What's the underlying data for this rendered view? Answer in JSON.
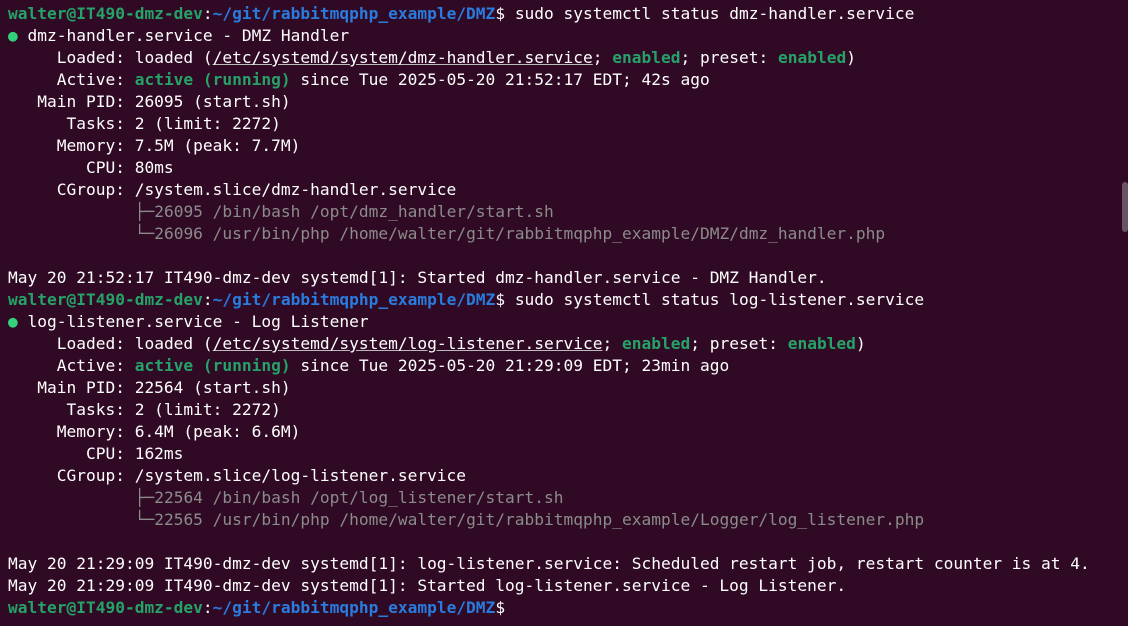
{
  "prompt": {
    "user_host": "walter@IT490-dmz-dev",
    "sep": ":",
    "path": "~/git/rabbitmqphp_example/DMZ",
    "dollar": "$ "
  },
  "commands": {
    "first": "sudo systemctl status dmz-handler.service",
    "second": "sudo systemctl status log-listener.service"
  },
  "service1": {
    "bullet": "●",
    "header": " dmz-handler.service - DMZ Handler",
    "loaded_label": "     Loaded: ",
    "loaded_pre": "loaded (",
    "loaded_path": "/etc/systemd/system/dmz-handler.service",
    "loaded_sep": "; ",
    "enabled1": "enabled",
    "loaded_mid": "; preset: ",
    "enabled2": "enabled",
    "loaded_end": ")",
    "active_label": "     Active: ",
    "active_state": "active (running)",
    "active_since": " since Tue 2025-05-20 21:52:17 EDT; 42s ago",
    "main_pid": "   Main PID: 26095 (start.sh)",
    "tasks": "      Tasks: 2 (limit: 2272)",
    "memory": "     Memory: 7.5M (peak: 7.7M)",
    "cpu": "        CPU: 80ms",
    "cgroup": "     CGroup: /system.slice/dmz-handler.service",
    "tree_indent": "             ",
    "proc1_branch": "├─",
    "proc1": "26095 /bin/bash /opt/dmz_handler/start.sh",
    "proc2_branch": "└─",
    "proc2": "26096 /usr/bin/php /home/walter/git/rabbitmqphp_example/DMZ/dmz_handler.php",
    "log1": "May 20 21:52:17 IT490-dmz-dev systemd[1]: Started dmz-handler.service - DMZ Handler."
  },
  "service2": {
    "bullet": "●",
    "header": " log-listener.service - Log Listener",
    "loaded_label": "     Loaded: ",
    "loaded_pre": "loaded (",
    "loaded_path": "/etc/systemd/system/log-listener.service",
    "loaded_sep": "; ",
    "enabled1": "enabled",
    "loaded_mid": "; preset: ",
    "enabled2": "enabled",
    "loaded_end": ")",
    "active_label": "     Active: ",
    "active_state": "active (running)",
    "active_since": " since Tue 2025-05-20 21:29:09 EDT; 23min ago",
    "main_pid": "   Main PID: 22564 (start.sh)",
    "tasks": "      Tasks: 2 (limit: 2272)",
    "memory": "     Memory: 6.4M (peak: 6.6M)",
    "cpu": "        CPU: 162ms",
    "cgroup": "     CGroup: /system.slice/log-listener.service",
    "tree_indent": "             ",
    "proc1_branch": "├─",
    "proc1": "22564 /bin/bash /opt/log_listener/start.sh",
    "proc2_branch": "└─",
    "proc2": "22565 /usr/bin/php /home/walter/git/rabbitmqphp_example/Logger/log_listener.php",
    "log1": "May 20 21:29:09 IT490-dmz-dev systemd[1]: log-listener.service: Scheduled restart job, restart counter is at 4.",
    "log2": "May 20 21:29:09 IT490-dmz-dev systemd[1]: Started log-listener.service - Log Listener."
  },
  "colors": {
    "background": "#300a24",
    "prompt_user": "#26a269",
    "prompt_path": "#2a7bde",
    "active_green": "#26a269",
    "status_dot": "#33d17a",
    "dim_text": "#8b8b8b"
  }
}
